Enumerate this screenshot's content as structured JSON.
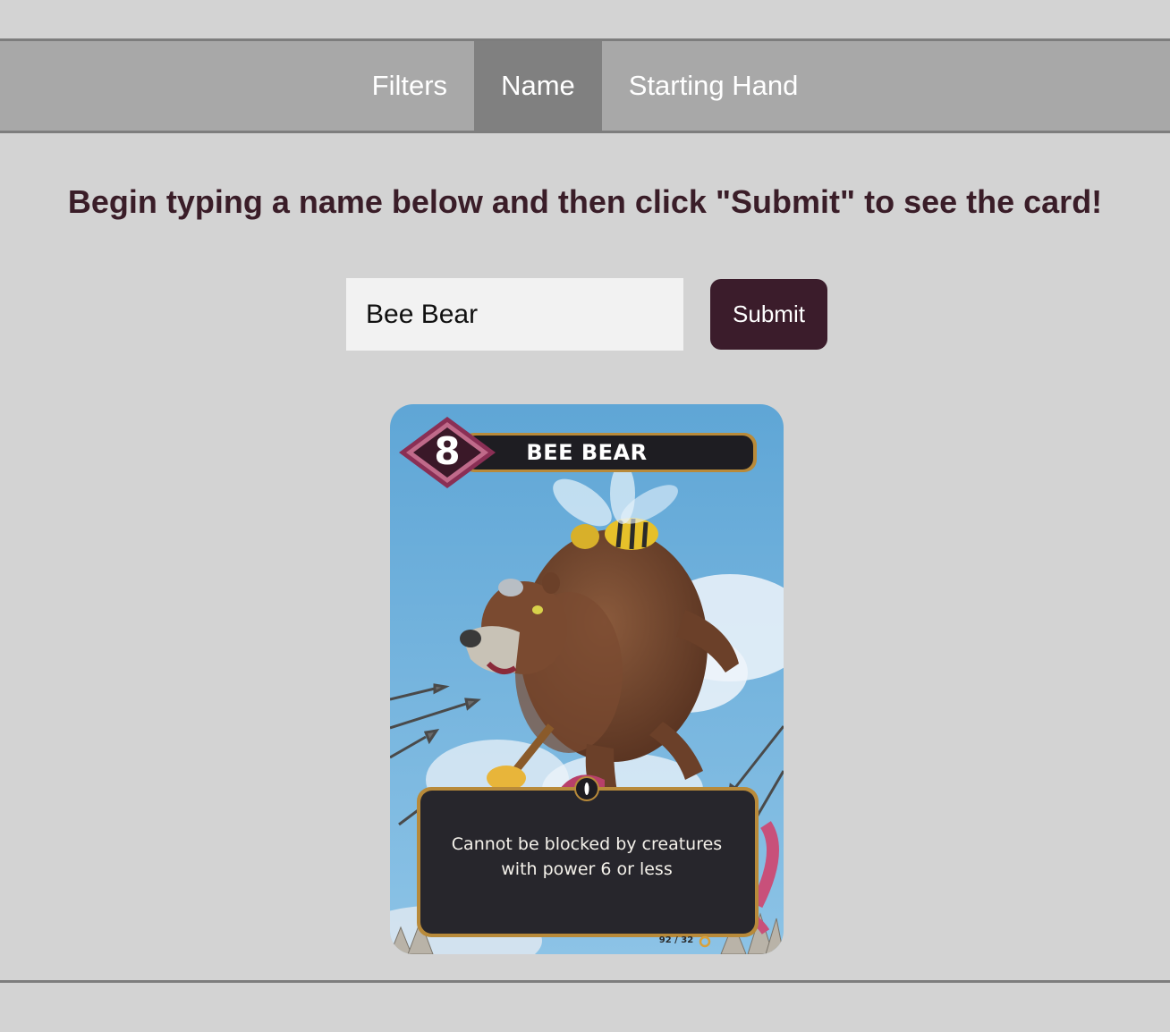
{
  "nav": {
    "tabs": [
      {
        "label": "Filters",
        "active": false
      },
      {
        "label": "Name",
        "active": true
      },
      {
        "label": "Starting Hand",
        "active": false
      }
    ]
  },
  "prompt": "Begin typing a name below and then click \"Submit\" to see the card!",
  "search": {
    "value": "Bee Bear",
    "placeholder": ""
  },
  "submit_label": "Submit",
  "card": {
    "name": "BEE BEAR",
    "power": "8",
    "ability": "Cannot be blocked by creatures with power 6 or less",
    "number": "92 / 32",
    "icons": [
      "power-gem-icon",
      "eye-icon",
      "set-ring-icon"
    ]
  },
  "colors": {
    "page_background": "#d3d3d3",
    "nav_background": "#a8a8a8",
    "nav_active": "#808080",
    "accent": "#3b1c2b"
  }
}
